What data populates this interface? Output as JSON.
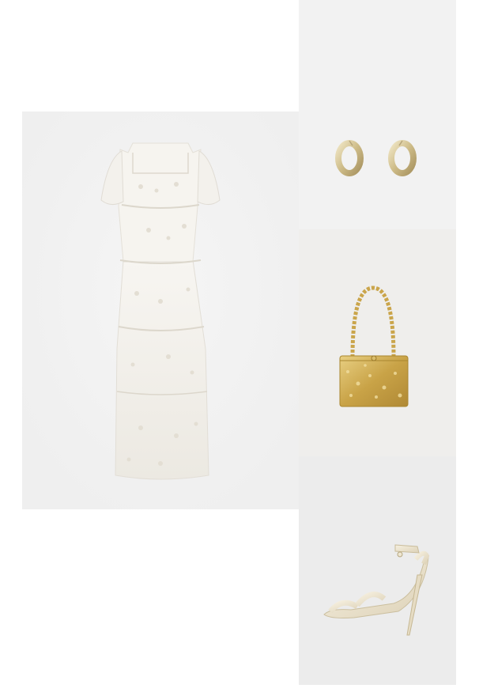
{
  "outfit": {
    "items": [
      {
        "id": "dress",
        "kind": "embroidered tulle maxi dress",
        "color": "#f4f1ea"
      },
      {
        "id": "hoops",
        "kind": "hoop earrings",
        "color": "#d8c99b"
      },
      {
        "id": "bag",
        "kind": "sequin box clutch with chain handle",
        "color": "#d6b25a"
      },
      {
        "id": "sandal",
        "kind": "strappy heeled sandal",
        "color": "#efe7d3"
      }
    ],
    "backgrounds": {
      "page": "#ffffff",
      "dress": "#efefef",
      "hoops": "#f2f2f2",
      "bag": "#efeeec",
      "sandal": "#ececec"
    }
  }
}
